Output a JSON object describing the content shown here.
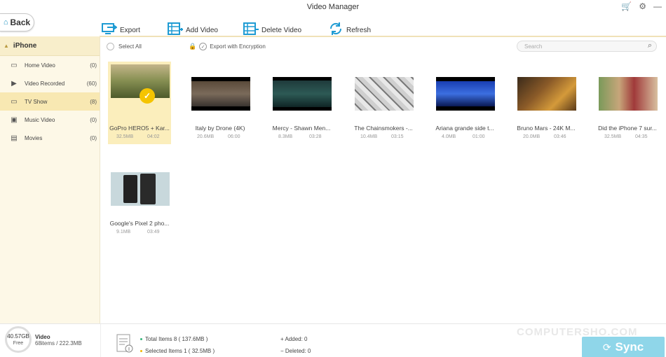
{
  "window": {
    "title": "Video Manager"
  },
  "back": {
    "label": "Back"
  },
  "toolbar": {
    "export_label": "Export",
    "add_label": "Add Video",
    "delete_label": "Delete Video",
    "refresh_label": "Refresh"
  },
  "sidebar": {
    "device": "iPhone",
    "items": [
      {
        "label": "Home Video",
        "count": "(0)"
      },
      {
        "label": "Video Recorded",
        "count": "(60)"
      },
      {
        "label": "TV Show",
        "count": "(8)"
      },
      {
        "label": "Music Video",
        "count": "(0)"
      },
      {
        "label": "Movies",
        "count": "(0)"
      }
    ]
  },
  "selection": {
    "select_all": "Select All",
    "export_encryption": "Export with Encryption",
    "search_placeholder": "Search"
  },
  "videos": [
    {
      "title": "GoPro HERO5 + Kar...",
      "size": "32.5MB",
      "duration": "04:02",
      "selected": true
    },
    {
      "title": "Italy by Drone (4K)",
      "size": "20.6MB",
      "duration": "06:00"
    },
    {
      "title": "Mercy - Shawn Men...",
      "size": "8.3MB",
      "duration": "03:28"
    },
    {
      "title": "The Chainsmokers -...",
      "size": "10.4MB",
      "duration": "03:15"
    },
    {
      "title": "Ariana grande side t...",
      "size": "4.0MB",
      "duration": "01:00"
    },
    {
      "title": "Bruno Mars - 24K M...",
      "size": "20.0MB",
      "duration": "03:46"
    },
    {
      "title": "Did the iPhone 7 sur...",
      "size": "32.5MB",
      "duration": "04:35"
    },
    {
      "title": "Google's Pixel 2 pho...",
      "size": "9.1MB",
      "duration": "03:49"
    }
  ],
  "bottom": {
    "free_space": "40.57GB",
    "free_label": "Free",
    "category": "Video",
    "category_stats": "68items / 222.3MB",
    "total_items": "Total Items 8 ( 137.6MB )",
    "selected_items": "Selected Items 1 ( 32.5MB )",
    "added": "Added: 0",
    "deleted": "Deleted: 0",
    "watermark": "COMPUTERSHO.COM",
    "sync_label": "Sync"
  }
}
